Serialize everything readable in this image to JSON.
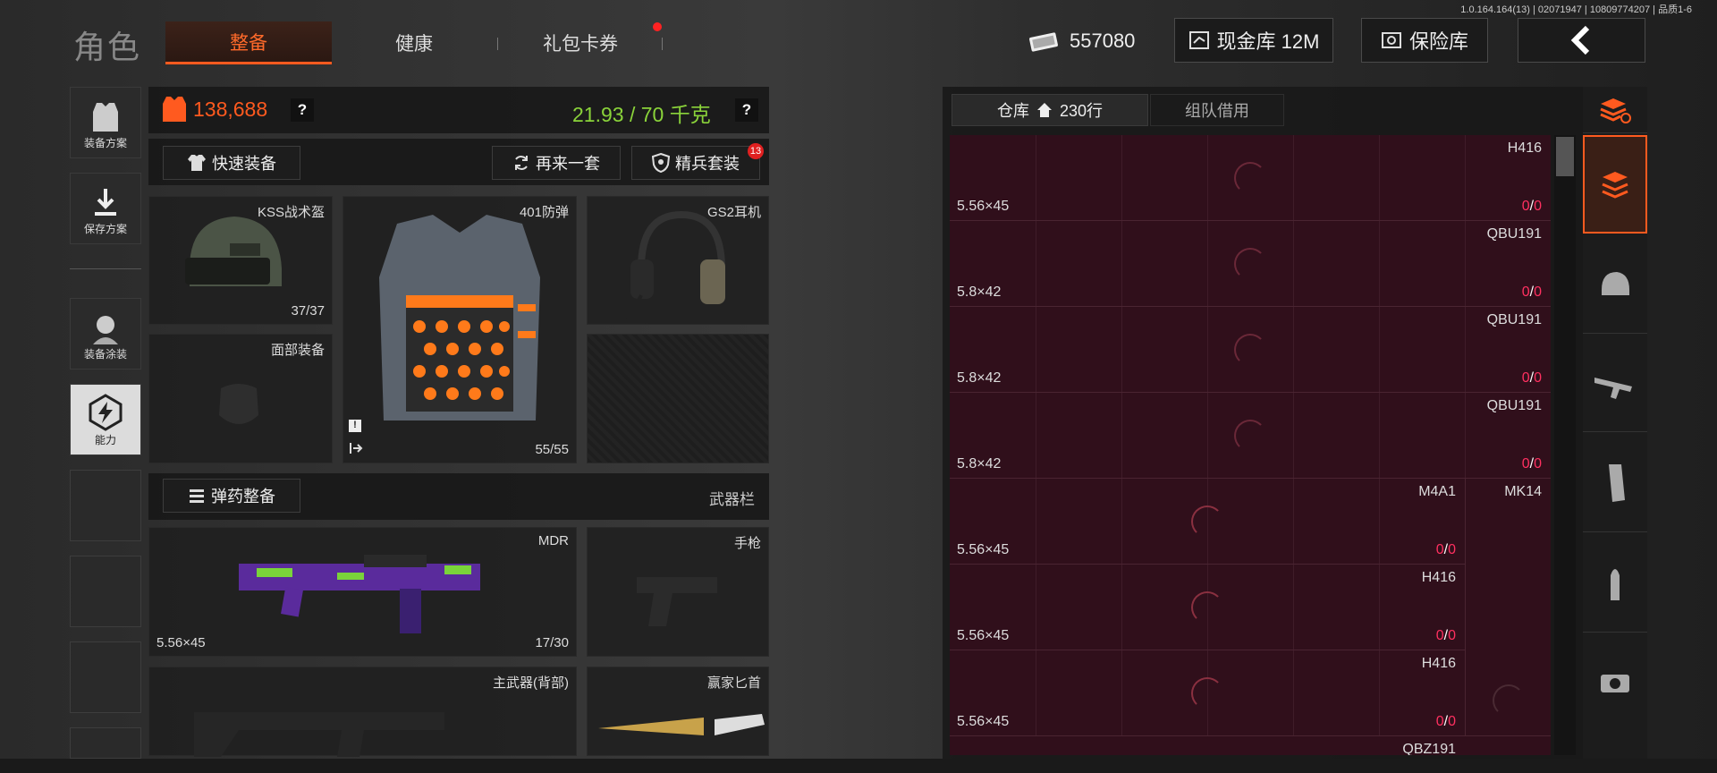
{
  "version": "1.0.164.164(13) | 02071947 | 10809774207 | 品质1-6",
  "title": "角色",
  "tabs": [
    {
      "label": "整备"
    },
    {
      "label": "健康"
    },
    {
      "label": "礼包卡券"
    }
  ],
  "currency": {
    "amount": "557080"
  },
  "buttons": {
    "cash_vault": "现金库 12M",
    "safe": "保险库"
  },
  "sidebar": {
    "items": [
      {
        "label": "装备方案"
      },
      {
        "label": "保存方案"
      },
      {
        "label": "装备涂装"
      },
      {
        "label": "能力"
      }
    ]
  },
  "loadout": {
    "value": "138,688",
    "weight": "21.93 / 70 千克",
    "quick_equip": "快速装备",
    "reroll": "再来一套",
    "elite_kit": "精兵套装",
    "elite_badge": "13",
    "slots": {
      "helmet": {
        "name": "KSS战术盔",
        "durability": "37/37"
      },
      "armor": {
        "name": "401防弹",
        "durability": "55/55"
      },
      "headset": {
        "name": "GS2耳机"
      },
      "face": {
        "name": "面部装备"
      }
    },
    "ammo_equip": "弹药整备",
    "weapon_bar": "武器栏",
    "weapons": {
      "primary": {
        "name": "MDR",
        "caliber": "5.56×45",
        "ammo": "17/30"
      },
      "pistol": {
        "name": "手枪"
      },
      "back": {
        "name": "主武器(背部)"
      },
      "melee": {
        "name": "赢家匕首"
      }
    }
  },
  "warehouse": {
    "tab_label": "仓库",
    "tab_count": "230行",
    "team_tab": "组队借用",
    "rows": [
      {
        "name": "H416",
        "caliber": "5.56×45",
        "have": "0",
        "total": "0"
      },
      {
        "name": "QBU191",
        "caliber": "5.8×42",
        "have": "0",
        "total": "0"
      },
      {
        "name": "QBU191",
        "caliber": "5.8×42",
        "have": "0",
        "total": "0"
      },
      {
        "name": "QBU191",
        "caliber": "5.8×42",
        "have": "0",
        "total": "0"
      },
      {
        "name": "M4A1",
        "caliber": "5.56×45",
        "have": "0",
        "total": "0",
        "extra": "MK14"
      },
      {
        "name": "H416",
        "caliber": "5.56×45",
        "have": "0",
        "total": "0"
      },
      {
        "name": "H416",
        "caliber": "5.56×45",
        "have": "0",
        "total": "0"
      },
      {
        "name": "QBZ191"
      }
    ]
  },
  "colors": {
    "accent": "#ff5a1f",
    "weight_green": "#8ad33a",
    "wh_bg": "#300f1b",
    "count_red": "#ff3060"
  }
}
